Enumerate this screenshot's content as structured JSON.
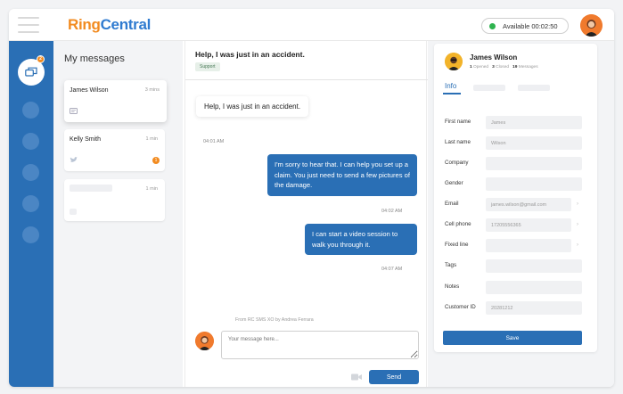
{
  "app": {
    "logo_ring": "Ring",
    "logo_central": "Central",
    "status": "Available 00:02:50",
    "accent_color": "#2a6fb5",
    "brand_orange": "#f28b20"
  },
  "rail": {
    "badge": "2"
  },
  "messages": {
    "title": "My messages",
    "items": [
      {
        "name": "James Wilson",
        "time": "3 mins",
        "icon": "sms-icon"
      },
      {
        "name": "Kelly Smith",
        "time": "1 min",
        "icon": "twitter-icon",
        "unread": "1"
      },
      {
        "name": "",
        "time": "1 min"
      }
    ]
  },
  "conversation": {
    "title": "Help, I was just in an accident.",
    "tag": "Support",
    "messages": [
      {
        "direction": "in",
        "text": "Help, I was just in an accident.",
        "time": "04:01 AM"
      },
      {
        "direction": "out",
        "text": "I'm sorry to hear that. I can help you set up a claim. You just need to send a few pictures of the damage.",
        "time": "04:02 AM"
      },
      {
        "direction": "out",
        "text": "I can start a video session to walk you through it.",
        "time": "04:07 AM"
      }
    ],
    "from_line": "From RC SMS XO by Andrea Ferrara",
    "composer_placeholder": "Your message here...",
    "send_label": "Send"
  },
  "contact": {
    "name": "James Wilson",
    "opened_count": "1",
    "opened_label": "Opened",
    "closed_count": "3",
    "closed_label": "Closed",
    "messages_count": "19",
    "messages_label": "Messages",
    "tab_info": "Info",
    "fields": [
      {
        "label": "First name",
        "value": "James"
      },
      {
        "label": "Last name",
        "value": "Wilson"
      },
      {
        "label": "Company",
        "value": ""
      },
      {
        "label": "Gender",
        "value": ""
      },
      {
        "label": "Email",
        "value": "james.wilson@gmail.com"
      },
      {
        "label": "Cell phone",
        "value": "17205556365"
      },
      {
        "label": "Fixed line",
        "value": ""
      },
      {
        "label": "Tags",
        "value": ""
      },
      {
        "label": "Notes",
        "value": ""
      },
      {
        "label": "Customer ID",
        "value": "20281212"
      }
    ],
    "save_label": "Save"
  }
}
